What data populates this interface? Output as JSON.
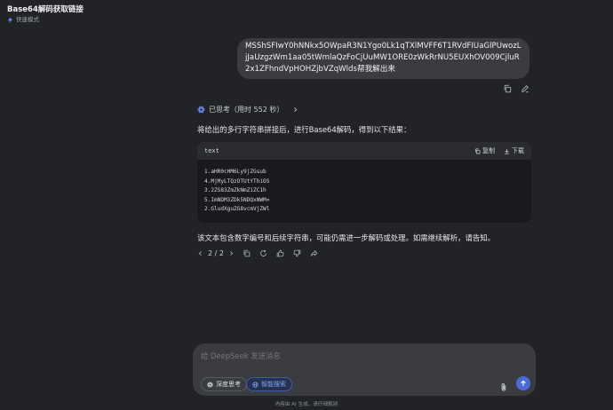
{
  "header": {
    "title": "Base64解码获取链接",
    "mode": "快速模式"
  },
  "user_message": {
    "text": "MSShSFIwY0hNNkx5OWpaR3N1Ygo0Lk1qTXlMVFF6T1RVdFIUaGlPUwozLjJaUzgzWm1aa05tWmlaQzFoCjUuMW1ORE0zWkRrNU5EUXhOV009CjluR2x1ZFhndVpHOHZjbVZqWlds帮我解出来"
  },
  "assistant": {
    "thinking_label": "已思考（用时 552 秒）",
    "intro": "将给出的多行字符串拼接后，进行Base64解码，得到以下结果：",
    "code": {
      "lang": "text",
      "copy_label": "复制",
      "download_label": "下载",
      "lines": [
        "1.aHR0cHM6Ly9jZGsub",
        "4.MjMyLTQzOTUtYThiOS",
        "3.2ZS83ZmZkNmZiZC1h",
        "5.ImNDM3ZDk5NDQxNWM=",
        "2.GludXguZG8vcmVjZWl"
      ]
    },
    "after": "该文本包含数字编号和后续字符串，可能仍需进一步解码或处理。如需继续解析，请告知。",
    "pager": "2 / 2"
  },
  "composer": {
    "placeholder": "给 DeepSeek 发送消息",
    "deep_think_label": "深度思考",
    "web_search_label": "智能搜索"
  },
  "footer": {
    "disclaimer": "内容由 AI 生成，请仔细甄别"
  }
}
